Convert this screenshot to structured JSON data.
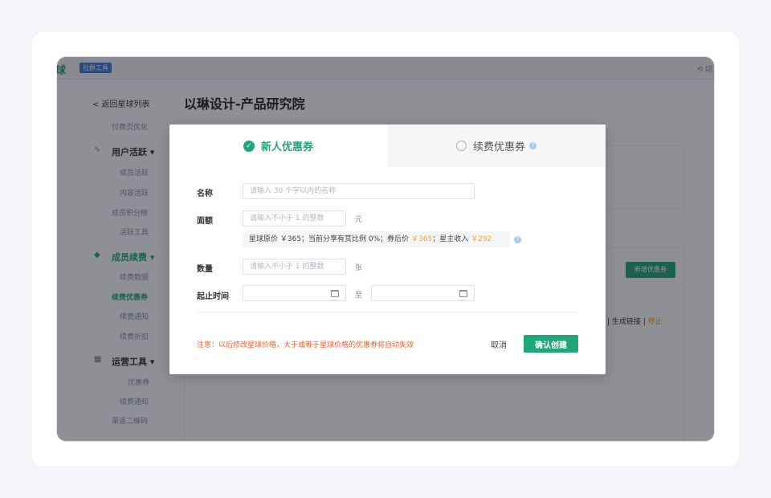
{
  "app": {
    "logo": "球",
    "badge": "社群工具",
    "switch_label": "切"
  },
  "page": {
    "title": "以琳设计-产品研究院",
    "back_label": "< 返回星球列表"
  },
  "sidebar": {
    "top_item": "付费页优化",
    "groups": [
      {
        "label": "用户活跃",
        "items": [
          "成员活跃",
          "内容活跃",
          "成员积分榜",
          "活跃工具"
        ]
      },
      {
        "label": "成员续费",
        "items": [
          "续费数据",
          "续费优惠券",
          "续费通知",
          "续费折扣"
        ]
      },
      {
        "label": "运营工具",
        "items": [
          "优惠券",
          "续费通知",
          "渠道二维码"
        ]
      }
    ]
  },
  "background": {
    "add_coupon_label": "新增优惠券",
    "links": {
      "generate": "生成链接",
      "stop": "停止"
    }
  },
  "modal": {
    "tabs": [
      {
        "label": "新人优惠券",
        "active": true
      },
      {
        "label": "续费优惠券",
        "active": false
      }
    ],
    "fields": {
      "name": {
        "label": "名称",
        "placeholder": "请输入 30 个字以内的名称"
      },
      "amount": {
        "label": "面额",
        "placeholder": "请输入不小于 1 的整数",
        "unit": "元"
      },
      "quantity": {
        "label": "数量",
        "placeholder": "请输入不小于 1 的整数",
        "unit": "张"
      },
      "period": {
        "label": "起止时间",
        "separator": "至"
      }
    },
    "info": {
      "prefix": "星球原价 ￥365；当前分享有赏比例 0%；券后价 ",
      "after_price": "￥365",
      "middle": "；星主收入 ",
      "owner_income": "￥292"
    },
    "note": "注意：以后修改星球价格，大于或等于星球价格的优惠券将自动失效",
    "cancel_label": "取消",
    "confirm_label": "确认创建"
  },
  "colors": {
    "accent": "#1fa67a",
    "warning": "#f0612e",
    "price_highlight": "#f5a623"
  }
}
